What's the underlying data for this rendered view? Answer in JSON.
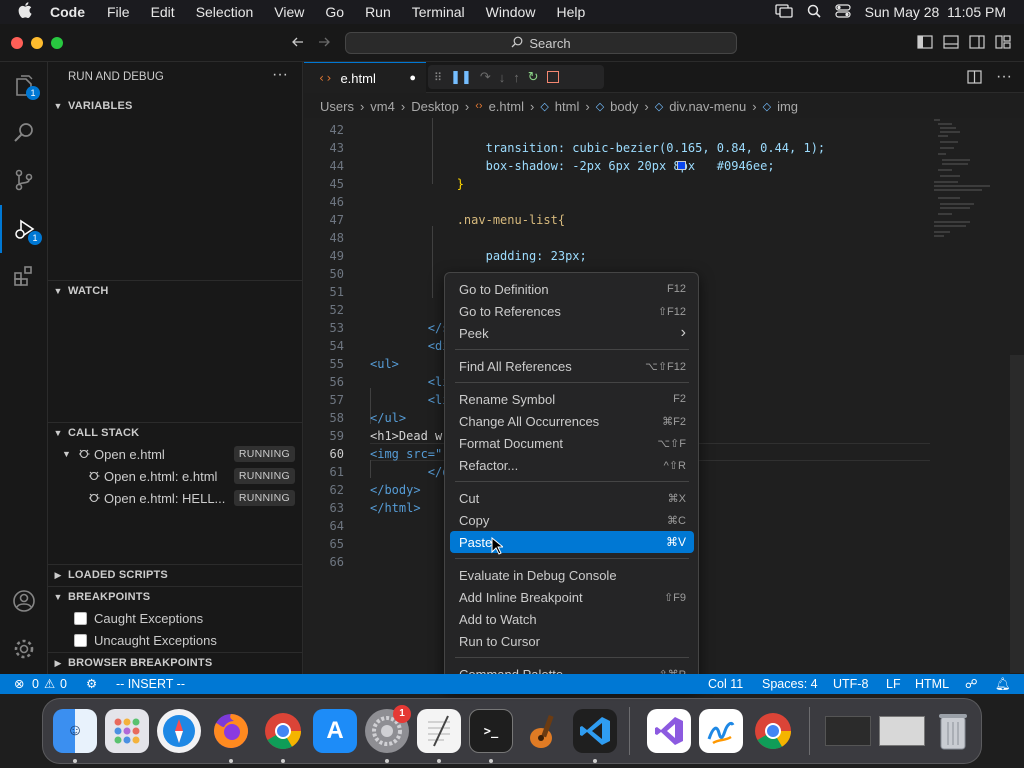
{
  "menubar": {
    "app": "Code",
    "items": [
      "File",
      "Edit",
      "Selection",
      "View",
      "Go",
      "Run",
      "Terminal",
      "Window",
      "Help"
    ],
    "clock": "Sun May 28  11:05 PM"
  },
  "titlebar": {
    "search": "Search"
  },
  "activity": {
    "explorer_badge": "1",
    "debug_badge": "1"
  },
  "sidebar": {
    "title": "RUN AND DEBUG",
    "variables": "VARIABLES",
    "watch": "WATCH",
    "call_stack": "CALL STACK",
    "call_stack_items": [
      {
        "label": "Open e.html",
        "status": "RUNNING"
      },
      {
        "label": "Open e.html: e.html",
        "status": "RUNNING"
      },
      {
        "label": "Open e.html: HELL...",
        "status": "RUNNING"
      }
    ],
    "loaded_scripts": "LOADED SCRIPTS",
    "breakpoints": "BREAKPOINTS",
    "breakpoint_items": [
      "Caught Exceptions",
      "Uncaught Exceptions"
    ],
    "browser_breakpoints": "BROWSER BREAKPOINTS"
  },
  "tab": {
    "name": "e.html",
    "modified": "●"
  },
  "breadcrumb": [
    "Users",
    "vm4",
    "Desktop",
    "e.html",
    "html",
    "body",
    "div.nav-menu",
    "img"
  ],
  "editor": {
    "current_line": "60",
    "lines": [
      {
        "n": "42",
        "t": ""
      },
      {
        "n": "43",
        "t": "                transition: cubic-bezier(0.165, 0.84, 0.44, 1);"
      },
      {
        "n": "44",
        "t": "                box-shadow: -2px 6px 20px 8px   #0946ee;"
      },
      {
        "n": "45",
        "t": "            }"
      },
      {
        "n": "46",
        "t": ""
      },
      {
        "n": "47",
        "t": "            .nav-menu-list{"
      },
      {
        "n": "48",
        "t": ""
      },
      {
        "n": "49",
        "t": "                padding: 23px;"
      },
      {
        "n": "50",
        "t": ""
      },
      {
        "n": "51",
        "t": "            }"
      },
      {
        "n": "52",
        "t": ""
      },
      {
        "n": "53",
        "t": "        </styl"
      },
      {
        "n": "54",
        "t": "        <div c"
      },
      {
        "n": "55",
        "t": "<ul>"
      },
      {
        "n": "56",
        "t": "        <li cl"
      },
      {
        "n": "57",
        "t": "        <li cl"
      },
      {
        "n": "58",
        "t": "</ul>"
      },
      {
        "n": "59",
        "t": "<h1>Dead w"
      },
      {
        "n": "60",
        "t": "<img src=\""
      },
      {
        "n": "61",
        "t": "        </div>"
      },
      {
        "n": "62",
        "t": "</body>"
      },
      {
        "n": "63",
        "t": "</html>"
      },
      {
        "n": "64",
        "t": ""
      },
      {
        "n": "65",
        "t": ""
      },
      {
        "n": "66",
        "t": ""
      }
    ]
  },
  "context_menu": {
    "items": [
      {
        "label": "Go to Definition",
        "shortcut": "F12"
      },
      {
        "label": "Go to References",
        "shortcut": "⇧F12"
      },
      {
        "label": "Peek",
        "shortcut": "›"
      },
      {
        "label": "Find All References",
        "shortcut": "⌥⇧F12"
      },
      {
        "label": "Rename Symbol",
        "shortcut": "F2"
      },
      {
        "label": "Change All Occurrences",
        "shortcut": "⌘F2"
      },
      {
        "label": "Format Document",
        "shortcut": "⌥⇧F"
      },
      {
        "label": "Refactor...",
        "shortcut": "^⇧R"
      },
      {
        "label": "Cut",
        "shortcut": "⌘X"
      },
      {
        "label": "Copy",
        "shortcut": "⌘C"
      },
      {
        "label": "Paste",
        "shortcut": "⌘V"
      },
      {
        "label": "Evaluate in Debug Console",
        "shortcut": ""
      },
      {
        "label": "Add Inline Breakpoint",
        "shortcut": "⇧F9"
      },
      {
        "label": "Add to Watch",
        "shortcut": ""
      },
      {
        "label": "Run to Cursor",
        "shortcut": ""
      },
      {
        "label": "Command Palette...",
        "shortcut": "⇧⌘P"
      }
    ],
    "selected": "Paste"
  },
  "statusbar": {
    "errors": "0",
    "warnings": "0",
    "mode": "-- INSERT --",
    "position": "Col 11",
    "spaces": "Spaces: 4",
    "encoding": "UTF-8",
    "eol": "LF",
    "language": "HTML"
  },
  "dock": {
    "apps": [
      "Finder",
      "Launchpad",
      "Safari",
      "Firefox",
      "Chrome",
      "App Store",
      "System Settings",
      "TextEdit",
      "Terminal",
      "GarageBand",
      "Visual Studio Code",
      "Visual Studio",
      "Freeform",
      "Chrome"
    ],
    "settings_badge": "1"
  },
  "colors": {
    "accent": "#0078d4",
    "swatch": "#0946ee"
  }
}
